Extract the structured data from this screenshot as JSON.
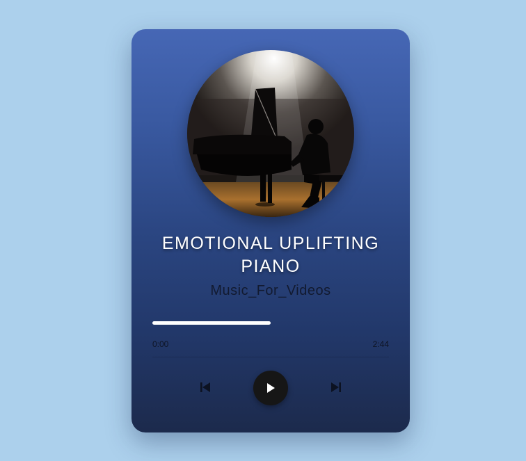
{
  "track": {
    "title": "EMOTIONAL UPLIFTING PIANO",
    "artist": "Music_For_Videos",
    "artwork_icon": "pianist-album-art"
  },
  "progress": {
    "current_time": "0:00",
    "duration": "2:44",
    "fraction": 0.5
  },
  "controls": {
    "previous_icon": "skip-previous-icon",
    "play_icon": "play-icon",
    "next_icon": "skip-next-icon"
  },
  "colors": {
    "background": "#acd0ec",
    "card_top": "#4667b5",
    "card_bottom": "#1c2a4c",
    "progress": "#ffffff",
    "play_button": "#161616"
  }
}
